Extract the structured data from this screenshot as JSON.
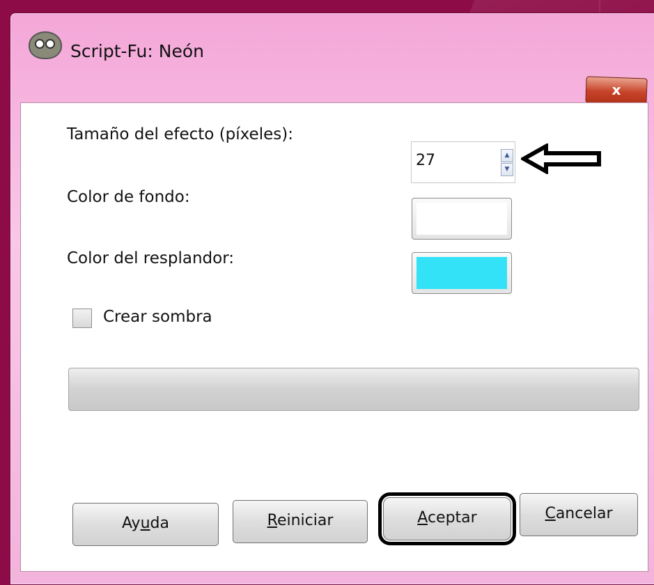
{
  "window": {
    "title": "Script-Fu: Neón",
    "close_label": "x"
  },
  "form": {
    "effect_size_label": "Tamaño del efecto (píxeles):",
    "effect_size_value": "27",
    "background_color_label": "Color de fondo:",
    "background_color": "#ffffff",
    "glow_color_label": "Color del resplandor:",
    "glow_color": "#33e2f7",
    "shadow_label": "Crear sombra",
    "shadow_checked": false
  },
  "buttons": {
    "help": {
      "pre": "Ay",
      "key": "u",
      "post": "da"
    },
    "reset": {
      "pre": "",
      "key": "R",
      "post": "einiciar"
    },
    "accept": {
      "pre": "",
      "key": "A",
      "post": "ceptar"
    },
    "cancel": {
      "pre": "",
      "key": "C",
      "post": "ancelar"
    }
  },
  "icons": {
    "app": "gimp-icon",
    "close": "close-icon",
    "spin_up": "spin-up-icon",
    "spin_down": "spin-down-icon",
    "annotation": "arrow-left-icon"
  },
  "colors": {
    "desktop": "#8d0c47",
    "frame": "#f4a7d8"
  }
}
